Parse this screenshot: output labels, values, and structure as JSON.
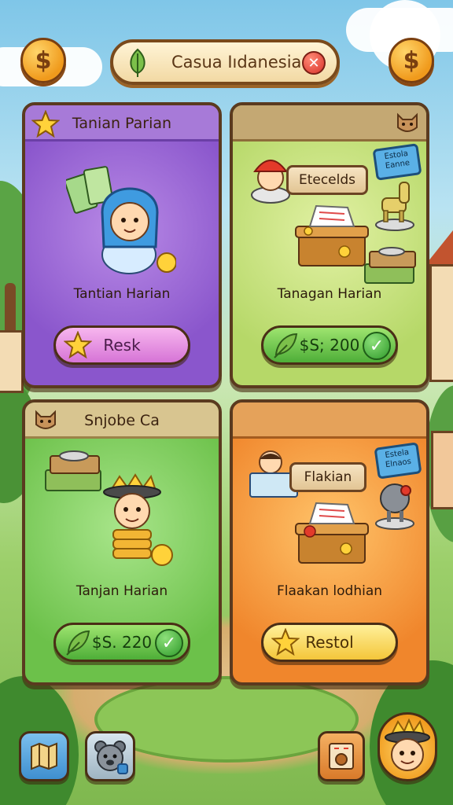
{
  "header": {
    "title": "Casua Iıdanesia",
    "left_coin_icon": "dollar-coin-icon",
    "right_coin_icon": "dollar-coin-icon",
    "left_coin_symbol": "$",
    "right_coin_symbol": "$",
    "close_symbol": "✕"
  },
  "cards": [
    {
      "title": "Tanian Parian",
      "caption": "Tantian Harian",
      "button_label": "Resk",
      "button_icon": "star-icon",
      "badge_icon": "star-icon",
      "color": "#8a56cc"
    },
    {
      "title": "",
      "sign_label": "Etecelds",
      "board_label": "Estola Eanne",
      "caption": "Tanagan Harian",
      "button_label": "$S; 200",
      "button_icon": "leaf-icon",
      "badge_icon": "animal-head-icon",
      "color": "#b6d868"
    },
    {
      "title": "Snjobe Ca",
      "caption": "Tanjan Harian",
      "button_label": "$S. 220",
      "button_icon": "leaf-icon",
      "badge_icon": "animal-head-icon",
      "color": "#6cc14a"
    },
    {
      "title": "",
      "sign_label": "Flakian",
      "board_label": "Estela Elnaos",
      "caption": "Flaakan lodhian",
      "button_label": "Restol",
      "button_icon": "star-icon",
      "color": "#f0862c"
    }
  ],
  "check_symbol": "✓",
  "bottom_bar": {
    "items": [
      "map-icon",
      "bear-pet-icon",
      "shop-icon",
      "avatar-icon"
    ]
  }
}
